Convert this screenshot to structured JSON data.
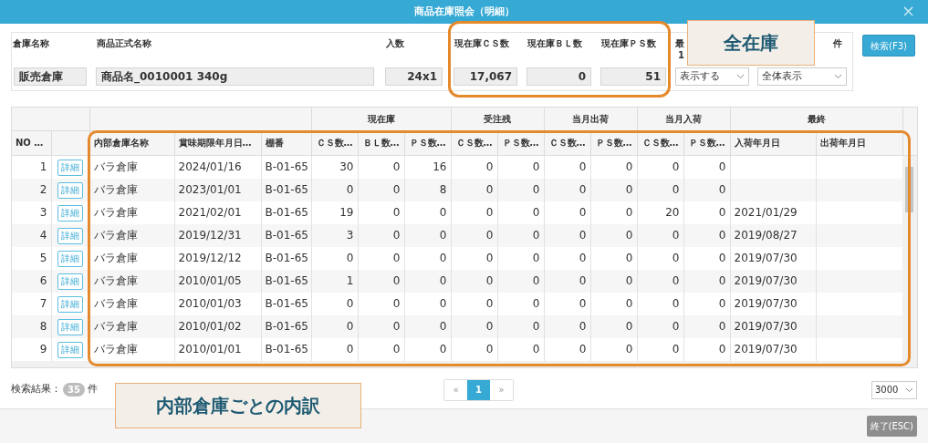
{
  "window": {
    "title": "商品在庫照会（明細）",
    "close": "×"
  },
  "header_fields": [
    {
      "kind": "text",
      "label": "倉庫名称",
      "value": "販売倉庫"
    },
    {
      "kind": "text",
      "label": "商品正式名称",
      "value": "商品名_0010001 340g"
    },
    {
      "kind": "text",
      "label": "入数",
      "value": "24x1"
    },
    {
      "kind": "text",
      "label": "現在庫ＣＳ数",
      "value": "17,067"
    },
    {
      "kind": "text",
      "label": "現在庫ＢＬ数",
      "value": "0"
    },
    {
      "kind": "text",
      "label": "現在庫ＰＳ数",
      "value": "51"
    },
    {
      "kind": "select",
      "label": "最",
      "sublabel": "1",
      "value": "表示する"
    },
    {
      "kind": "select",
      "label": "件",
      "value": "全体表示"
    }
  ],
  "search_button": "検索(F3)",
  "column_groups": [
    "現在庫",
    "受注残",
    "当月出荷",
    "当月入荷",
    "最終"
  ],
  "columns": [
    "NO …",
    "内部倉庫名称",
    "賞味期限年月日…",
    "棚番",
    "ＣＳ数…",
    "ＢＬ数…",
    "ＰＳ数…",
    "ＣＳ数…",
    "ＰＳ数…",
    "ＣＳ数…",
    "ＰＳ数…",
    "ＣＳ数…",
    "ＰＳ数…",
    "入荷年月日",
    "出荷年月日"
  ],
  "rows": [
    {
      "no": "1",
      "action": "詳細",
      "cells": [
        "バラ倉庫",
        "2024/01/16",
        "B-01-65",
        "30",
        "0",
        "16",
        "0",
        "0",
        "0",
        "0",
        "0",
        "0"
      ]
    },
    {
      "no": "2",
      "action": "詳細",
      "cells": [
        "バラ倉庫",
        "2023/01/01",
        "B-01-65",
        "0",
        "0",
        "8",
        "0",
        "0",
        "0",
        "0",
        "0",
        "0"
      ]
    },
    {
      "no": "3",
      "action": "詳細",
      "cells": [
        "バラ倉庫",
        "2021/02/01",
        "B-01-65",
        "19",
        "0",
        "0",
        "0",
        "0",
        "0",
        "0",
        "20",
        "0"
      ],
      "arrival": "2021/01/29"
    },
    {
      "no": "4",
      "action": "詳細",
      "cells": [
        "バラ倉庫",
        "2019/12/31",
        "B-01-65",
        "3",
        "0",
        "0",
        "0",
        "0",
        "0",
        "0",
        "0",
        "0"
      ],
      "arrival": "2019/08/27"
    },
    {
      "no": "5",
      "action": "詳細",
      "cells": [
        "バラ倉庫",
        "2019/12/12",
        "B-01-65",
        "0",
        "0",
        "0",
        "0",
        "0",
        "0",
        "0",
        "0",
        "0"
      ],
      "arrival": "2019/07/30"
    },
    {
      "no": "6",
      "action": "詳細",
      "cells": [
        "バラ倉庫",
        "2010/01/05",
        "B-01-65",
        "1",
        "0",
        "0",
        "0",
        "0",
        "0",
        "0",
        "0",
        "0"
      ],
      "arrival": "2019/07/30"
    },
    {
      "no": "7",
      "action": "詳細",
      "cells": [
        "バラ倉庫",
        "2010/01/03",
        "B-01-65",
        "0",
        "0",
        "0",
        "0",
        "0",
        "0",
        "0",
        "0",
        "0"
      ],
      "arrival": "2019/07/30"
    },
    {
      "no": "8",
      "action": "詳細",
      "cells": [
        "バラ倉庫",
        "2010/01/02",
        "B-01-65",
        "0",
        "0",
        "0",
        "0",
        "0",
        "0",
        "0",
        "0",
        "0"
      ],
      "arrival": "2019/07/30"
    },
    {
      "no": "9",
      "action": "詳細",
      "cells": [
        "バラ倉庫",
        "2010/01/01",
        "B-01-65",
        "0",
        "0",
        "0",
        "0",
        "0",
        "0",
        "0",
        "0",
        "0"
      ],
      "arrival": "2019/07/30"
    }
  ],
  "result": {
    "label": "検索結果：",
    "count": "35",
    "unit": "件"
  },
  "pagination": [
    {
      "label": "«",
      "selected": false
    },
    {
      "label": "1",
      "selected": true
    },
    {
      "label": "»",
      "selected": false
    }
  ],
  "page_size": "3000",
  "exit_button": {
    "label": "終了(ESC)",
    "disabled": true
  },
  "annotations": [
    "全在庫",
    "内部倉庫ごとの内訳"
  ]
}
